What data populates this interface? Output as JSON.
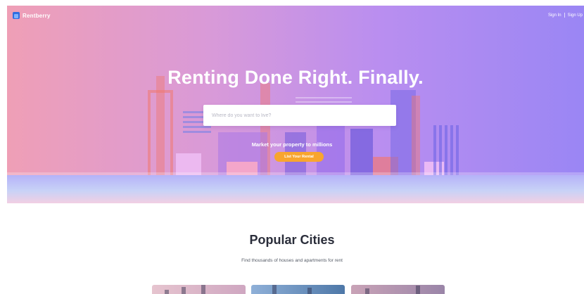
{
  "header": {
    "logo_text": "Rentberry",
    "sign_in": "Sign In",
    "sign_up": "Sign Up"
  },
  "hero": {
    "headline": "Renting Done Right. Finally.",
    "search_placeholder": "Where do you want to live?",
    "market_text": "Market your property to millions",
    "cta_label": "List Your Rental"
  },
  "popular": {
    "title": "Popular Cities",
    "subtitle": "Find thousands of houses and apartments for rent"
  },
  "colors": {
    "cta": "#f8a52e",
    "logo": "#2f6de0",
    "heading": "#2a2d3a"
  }
}
